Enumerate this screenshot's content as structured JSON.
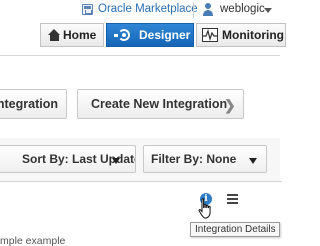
{
  "header": {
    "marketplace_link": "Oracle Marketplace",
    "user_name": "weblogic",
    "tabs": [
      {
        "label": "Home",
        "icon": "home-icon",
        "active": false
      },
      {
        "label": "Designer",
        "icon": "designer-icon",
        "active": true
      },
      {
        "label": "Monitoring",
        "icon": "monitoring-icon",
        "active": false
      }
    ]
  },
  "actions": {
    "import_label": "Integration",
    "create_label": "Create New Integration",
    "create_icon": "chevron-right-icon"
  },
  "filters": {
    "sort_label": "Sort By: Last Update",
    "filter_label": "Filter By: None"
  },
  "card": {
    "description": "mple example",
    "info_icon": "info-icon",
    "menu_icon": "hamburger-menu-icon"
  },
  "tooltip": {
    "text": "Integration Details"
  },
  "colors": {
    "accent": "#1a6dc0",
    "link": "#2b6fb2"
  }
}
